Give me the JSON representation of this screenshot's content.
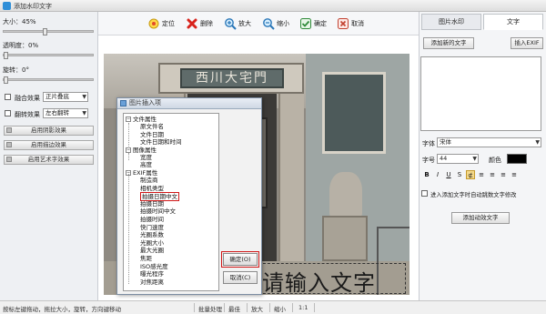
{
  "window": {
    "title": "添加水印文字"
  },
  "left_panel": {
    "size_label": "大小：45%",
    "size_value": 45,
    "opacity_label": "透明度：0%",
    "opacity_value": 0,
    "rotate_label": "旋转：0°",
    "rotate_value": 0,
    "blend_label": "融合效果",
    "blend_value": "正片叠底",
    "flip_label": "翻转效果",
    "flip_value": "左右翻转",
    "buttons": [
      "启用阴影效果",
      "启用描边效果",
      "启用艺术字效果"
    ]
  },
  "toolbar": {
    "items": [
      {
        "label": "定位",
        "icon": "locate-icon"
      },
      {
        "label": "删除",
        "icon": "delete-icon"
      },
      {
        "label": "放大",
        "icon": "zoom-in-icon"
      },
      {
        "label": "缩小",
        "icon": "zoom-out-icon"
      },
      {
        "label": "确定",
        "icon": "confirm-icon"
      },
      {
        "label": "取消",
        "icon": "cancel-icon"
      }
    ]
  },
  "canvas": {
    "plaque_text": "西川大宅門",
    "watermark_text": "请输入文字"
  },
  "dialog": {
    "title": "图片插入项",
    "tree": [
      {
        "text": "文件属性",
        "level": 0,
        "group": true
      },
      {
        "text": "原文件名",
        "level": 1
      },
      {
        "text": "文件日期",
        "level": 1
      },
      {
        "text": "文件日期和时间",
        "level": 1
      },
      {
        "text": "图像属性",
        "level": 0,
        "group": true
      },
      {
        "text": "宽度",
        "level": 1
      },
      {
        "text": "高度",
        "level": 1
      },
      {
        "text": "EXIF属性",
        "level": 0,
        "group": true
      },
      {
        "text": "制造商",
        "level": 1
      },
      {
        "text": "相机类型",
        "level": 1
      },
      {
        "text": "拍摄日期中文",
        "level": 1,
        "selected": true
      },
      {
        "text": "拍摄日期",
        "level": 1
      },
      {
        "text": "拍摄时间中文",
        "level": 1
      },
      {
        "text": "拍摄时间",
        "level": 1
      },
      {
        "text": "快门速度",
        "level": 1
      },
      {
        "text": "光圈系数",
        "level": 1
      },
      {
        "text": "光圈大小",
        "level": 1
      },
      {
        "text": "最大光圈",
        "level": 1
      },
      {
        "text": "焦距",
        "level": 1
      },
      {
        "text": "ISO感光度",
        "level": 1
      },
      {
        "text": "曝光程序",
        "level": 1
      },
      {
        "text": "对焦距离",
        "level": 1
      }
    ],
    "ok_label": "确定(O)",
    "cancel_label": "取消(C)"
  },
  "right_panel": {
    "tabs": [
      {
        "label": "图片水印",
        "active": false
      },
      {
        "label": "文字",
        "active": true
      }
    ],
    "add_text_button": "添加新的文字",
    "insert_exif_button": "插入EXIF",
    "font_label": "字体",
    "font_value": "宋体",
    "size_label": "字号",
    "size_value": "44",
    "color_label": "颜色",
    "color_value": "#000000",
    "format_buttons": [
      "B",
      "I",
      "U",
      "S",
      "⊄",
      "≡",
      "≡",
      "≡",
      "≡"
    ],
    "active_format": 4,
    "auto_text_label": "进入添加文字时自动跳数文字修改",
    "add_effect_button": "添加动效文字"
  },
  "statusbar": {
    "hint": "按标左键拖动，拖拉大小，旋转，方向键移动",
    "items": [
      "批量处理",
      "最佳",
      "放大",
      "缩小",
      "1:1"
    ]
  }
}
